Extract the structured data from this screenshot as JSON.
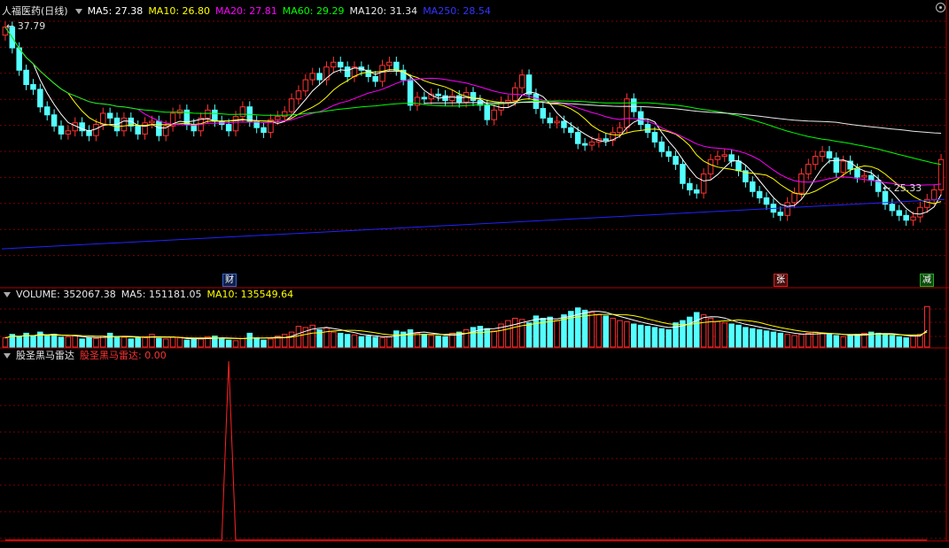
{
  "header": {
    "stock_name": "人福医药(日线)",
    "ma5_label": "MA5: 27.38",
    "ma10_label": "MA10: 26.80",
    "ma20_label": "MA20: 27.81",
    "ma60_label": "MA60: 29.29",
    "ma120_label": "MA120: 31.34",
    "ma250_label": "MA250: 28.54"
  },
  "price_annotations": {
    "high": "37.79",
    "low": "25.33"
  },
  "markers": {
    "cai": "财",
    "zhang": "张",
    "jian": "减"
  },
  "volume_header": {
    "volume_label": "VOLUME: 352067.38",
    "ma5_label": "MA5: 151181.05",
    "ma10_label": "MA10: 135549.64"
  },
  "indicator_header": {
    "name": "股圣黑马雷达",
    "value_label": "股圣黑马雷达: 0.00"
  },
  "colors": {
    "up": "#ff3232",
    "down": "#54ffff",
    "ma5": "#ffffff",
    "ma10": "#ffff00",
    "ma20": "#ff00ff",
    "ma60": "#00ff00",
    "ma120": "#e8e8e8",
    "ma250": "#2222ff",
    "grid": "#7a0000",
    "border": "#b00000",
    "indicator": "#ff2222"
  },
  "chart_data": {
    "type": "candlestick",
    "y_range": [
      22.0,
      38.2
    ],
    "open": [
      37.0,
      37.5,
      36.2,
      34.8,
      33.9,
      33.6,
      32.5,
      32.0,
      31.3,
      30.8,
      31.0,
      31.5,
      31.0,
      30.7,
      31.4,
      32.1,
      31.8,
      31.0,
      31.8,
      31.3,
      30.8,
      31.5,
      31.6,
      30.7,
      31.3,
      32.1,
      32.3,
      31.4,
      31.0,
      31.8,
      32.3,
      31.6,
      31.4,
      31.0,
      31.9,
      32.5,
      31.6,
      31.2,
      30.9,
      31.7,
      31.9,
      32.2,
      33.0,
      33.5,
      34.2,
      34.6,
      34.2,
      35.0,
      35.3,
      35.0,
      34.4,
      35.0,
      34.8,
      34.4,
      34.1,
      35.1,
      35.3,
      34.8,
      34.2,
      32.6,
      33.1,
      33.0,
      33.3,
      33.2,
      32.9,
      33.2,
      32.8,
      33.4,
      32.9,
      32.6,
      31.7,
      32.3,
      32.8,
      32.9,
      33.7,
      34.5,
      33.3,
      32.4,
      31.8,
      31.5,
      31.6,
      31.2,
      30.9,
      30.2,
      30.1,
      30.3,
      30.5,
      30.4,
      30.9,
      31.2,
      33.0,
      32.2,
      31.4,
      30.9,
      30.3,
      29.7,
      29.4,
      28.9,
      27.7,
      27.3,
      27.1,
      28.3,
      29.2,
      29.4,
      29.5,
      29.1,
      28.5,
      27.8,
      27.2,
      26.8,
      26.4,
      25.9,
      25.7,
      26.5,
      27.1,
      28.3,
      28.9,
      29.4,
      29.7,
      29.3,
      28.4,
      29.1,
      28.6,
      28.1,
      28.2,
      27.9,
      27.2,
      26.4,
      26.0,
      25.7,
      25.4,
      25.6,
      26.2,
      26.7,
      27.3
    ],
    "close": [
      37.5,
      36.2,
      34.8,
      33.9,
      33.6,
      32.5,
      32.0,
      31.3,
      30.8,
      31.0,
      31.5,
      31.0,
      30.7,
      31.4,
      32.1,
      31.8,
      31.0,
      31.8,
      31.3,
      30.8,
      31.5,
      31.6,
      30.7,
      31.3,
      32.1,
      32.3,
      31.4,
      31.0,
      31.8,
      32.3,
      31.6,
      31.4,
      31.0,
      31.9,
      32.5,
      31.6,
      31.2,
      30.9,
      31.7,
      31.9,
      32.2,
      33.0,
      33.5,
      34.2,
      34.6,
      34.2,
      35.0,
      35.3,
      35.0,
      34.4,
      35.0,
      34.8,
      34.4,
      34.1,
      35.1,
      35.3,
      34.8,
      34.2,
      32.6,
      33.1,
      33.0,
      33.3,
      33.2,
      32.9,
      33.2,
      32.8,
      33.4,
      32.9,
      32.6,
      31.7,
      32.3,
      32.8,
      32.9,
      33.7,
      34.5,
      33.3,
      32.4,
      31.8,
      31.5,
      31.6,
      31.2,
      30.9,
      30.2,
      30.1,
      30.3,
      30.5,
      30.4,
      30.9,
      31.2,
      33.0,
      32.2,
      31.4,
      30.9,
      30.3,
      29.7,
      29.4,
      28.9,
      27.7,
      27.3,
      27.1,
      28.3,
      29.2,
      29.4,
      29.5,
      29.1,
      28.5,
      27.8,
      27.2,
      26.8,
      26.4,
      25.9,
      25.7,
      26.5,
      27.1,
      28.3,
      28.9,
      29.4,
      29.7,
      29.3,
      28.4,
      29.1,
      28.6,
      28.1,
      28.2,
      27.9,
      27.2,
      26.4,
      26.0,
      25.7,
      25.4,
      25.6,
      26.2,
      26.7,
      27.3,
      29.2
    ],
    "ma250": [
      23.6,
      26.7
    ],
    "volume_range": [
      0,
      400000
    ],
    "volume": [
      80000,
      110000,
      90000,
      120000,
      95000,
      130000,
      100000,
      110000,
      85000,
      90000,
      100000,
      70000,
      80000,
      75000,
      95000,
      120000,
      90000,
      85000,
      70000,
      80000,
      90000,
      110000,
      75000,
      70000,
      85000,
      80000,
      60000,
      65000,
      70000,
      90000,
      95000,
      80000,
      60000,
      55000,
      75000,
      120000,
      80000,
      60000,
      70000,
      95000,
      110000,
      130000,
      180000,
      170000,
      190000,
      150000,
      165000,
      130000,
      120000,
      110000,
      105000,
      90000,
      95000,
      85000,
      80000,
      90000,
      140000,
      130000,
      150000,
      120000,
      110000,
      100000,
      95000,
      90000,
      120000,
      130000,
      150000,
      170000,
      180000,
      160000,
      140000,
      200000,
      230000,
      250000,
      240000,
      210000,
      270000,
      250000,
      260000,
      230000,
      280000,
      310000,
      340000,
      320000,
      300000,
      280000,
      270000,
      250000,
      230000,
      220000,
      200000,
      190000,
      180000,
      170000,
      160000,
      150000,
      210000,
      230000,
      260000,
      300000,
      280000,
      250000,
      220000,
      210000,
      200000,
      190000,
      170000,
      160000,
      150000,
      140000,
      130000,
      120000,
      110000,
      100000,
      110000,
      120000,
      130000,
      120000,
      110000,
      100000,
      90000,
      100000,
      110000,
      120000,
      130000,
      120000,
      110000,
      100000,
      90000,
      80000,
      95000,
      110000,
      352067
    ],
    "indicator_range": [
      0,
      1
    ],
    "indicator": [
      0,
      0,
      0,
      0,
      0,
      0,
      0,
      0,
      0,
      0,
      0,
      0,
      0,
      0,
      0,
      0,
      0,
      0,
      0,
      0,
      0,
      0,
      0,
      0,
      0,
      0,
      0,
      0,
      0,
      0,
      0,
      0,
      1,
      0,
      0,
      0,
      0,
      0,
      0,
      0,
      0,
      0,
      0,
      0,
      0,
      0,
      0,
      0,
      0,
      0,
      0,
      0,
      0,
      0,
      0,
      0,
      0,
      0,
      0,
      0,
      0,
      0,
      0,
      0,
      0,
      0,
      0,
      0,
      0,
      0,
      0,
      0,
      0,
      0,
      0,
      0,
      0,
      0,
      0,
      0,
      0,
      0,
      0,
      0,
      0,
      0,
      0,
      0,
      0,
      0,
      0,
      0,
      0,
      0,
      0,
      0,
      0,
      0,
      0,
      0,
      0,
      0,
      0,
      0,
      0,
      0,
      0,
      0,
      0,
      0,
      0,
      0,
      0,
      0,
      0,
      0,
      0,
      0,
      0,
      0,
      0,
      0,
      0,
      0,
      0,
      0,
      0,
      0,
      0,
      0,
      0,
      0,
      0
    ]
  }
}
